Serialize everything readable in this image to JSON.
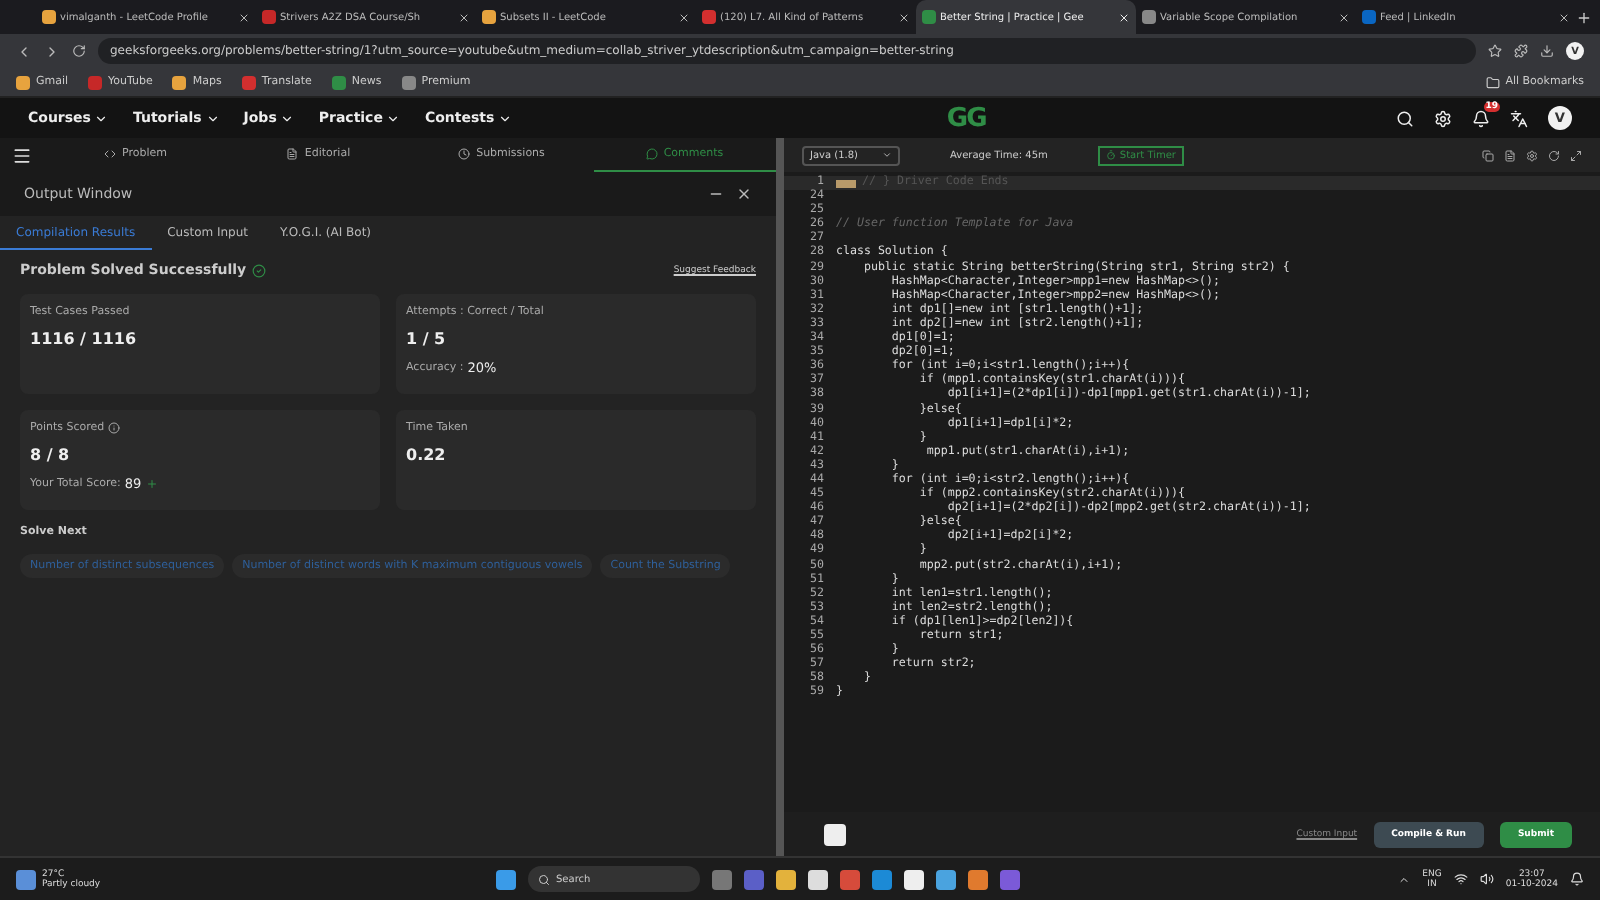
{
  "browser": {
    "tabs": [
      {
        "title": "vimalganth - LeetCode Profile",
        "selected": false
      },
      {
        "title": "Strivers A2Z DSA Course/Sh",
        "selected": false
      },
      {
        "title": "Subsets II - LeetCode",
        "selected": false
      },
      {
        "title": "(120) L7. All Kind of Patterns",
        "selected": false
      },
      {
        "title": "Better String | Practice | Gee",
        "selected": true
      },
      {
        "title": "Variable Scope Compilation",
        "selected": false
      },
      {
        "title": "Feed | LinkedIn",
        "selected": false
      }
    ],
    "url": "geeksforgeeks.org/problems/better-string/1?utm_source=youtube&utm_medium=collab_striver_ytdescription&utm_campaign=better-string",
    "profile_initial": "V",
    "bookmarks": [
      "Gmail",
      "YouTube",
      "Maps",
      "Translate",
      "News",
      "Premium"
    ],
    "all_bookmarks": "All Bookmarks"
  },
  "site_nav": {
    "menus": [
      "Courses",
      "Tutorials",
      "Jobs",
      "Practice",
      "Contests"
    ],
    "logo": "GG",
    "notification_count": "19",
    "avatar": "V"
  },
  "problem_tabs": [
    {
      "label": "Problem",
      "selected": false
    },
    {
      "label": "Editorial",
      "selected": false
    },
    {
      "label": "Submissions",
      "selected": false
    },
    {
      "label": "Comments",
      "selected": true
    }
  ],
  "output_window": {
    "title": "Output Window",
    "tabs": [
      {
        "label": "Compilation Results",
        "selected": true
      },
      {
        "label": "Custom Input",
        "selected": false
      },
      {
        "label": "Y.O.G.I. (AI Bot)",
        "selected": false
      }
    ],
    "status": "Problem Solved Successfully",
    "feedback": "Suggest Feedback",
    "cards": [
      {
        "label": "Test Cases Passed",
        "value": "1116 / 1116"
      },
      {
        "label": "Attempts : Correct / Total",
        "value": "1 / 5",
        "note_label": "Accuracy :",
        "note_value": "20%"
      },
      {
        "label": "Points Scored",
        "value": "8 / 8",
        "note_label": "Your Total Score:",
        "note_value": "89",
        "info": true,
        "up": true
      },
      {
        "label": "Time Taken",
        "value": "0.22"
      }
    ],
    "solve_next_title": "Solve Next",
    "solve_next": [
      "Number of distinct subsequences",
      "Number of distinct words with K maximum contiguous vowels",
      "Count the Substring"
    ]
  },
  "editor": {
    "language": "Java (1.8)",
    "average_time": "Average Time: 45m",
    "timer": "Start Timer",
    "lines": [
      {
        "n": "1",
        "kind": "folded",
        "text": "// } Driver Code Ends"
      },
      {
        "n": "24",
        "kind": "code"
      },
      {
        "n": "25",
        "kind": "code"
      },
      {
        "n": "26",
        "kind": "comment",
        "text": "// User function Template for Java"
      },
      {
        "n": "27",
        "kind": "code"
      },
      {
        "n": "28",
        "kind": "code",
        "text": "class Solution {"
      },
      {
        "n": "29",
        "kind": "code",
        "text": "    public static String betterString(String str1, String str2) {"
      },
      {
        "n": "30",
        "kind": "code",
        "text": "        HashMap<Character,Integer>mpp1=new HashMap<>();"
      },
      {
        "n": "31",
        "kind": "code",
        "text": "        HashMap<Character,Integer>mpp2=new HashMap<>();"
      },
      {
        "n": "32",
        "kind": "code",
        "text": "        int dp1[]=new int [str1.length()+1];"
      },
      {
        "n": "33",
        "kind": "code",
        "text": "        int dp2[]=new int [str2.length()+1];"
      },
      {
        "n": "34",
        "kind": "code",
        "text": "        dp1[0]=1;"
      },
      {
        "n": "35",
        "kind": "code",
        "text": "        dp2[0]=1;"
      },
      {
        "n": "36",
        "kind": "code",
        "text": "        for (int i=0;i<str1.length();i++){"
      },
      {
        "n": "37",
        "kind": "code",
        "text": "            if (mpp1.containsKey(str1.charAt(i))){"
      },
      {
        "n": "38",
        "kind": "code",
        "text": "                dp1[i+1]=(2*dp1[i])-dp1[mpp1.get(str1.charAt(i))-1];"
      },
      {
        "n": "39",
        "kind": "code",
        "text": "            }else{"
      },
      {
        "n": "40",
        "kind": "code",
        "text": "                dp1[i+1]=dp1[i]*2;"
      },
      {
        "n": "41",
        "kind": "code",
        "text": "            }"
      },
      {
        "n": "42",
        "kind": "code",
        "text": "             mpp1.put(str1.charAt(i),i+1);"
      },
      {
        "n": "43",
        "kind": "code",
        "text": "        }"
      },
      {
        "n": "44",
        "kind": "code",
        "text": "        for (int i=0;i<str2.length();i++){"
      },
      {
        "n": "45",
        "kind": "code",
        "text": "            if (mpp2.containsKey(str2.charAt(i))){"
      },
      {
        "n": "46",
        "kind": "code",
        "text": "                dp2[i+1]=(2*dp2[i])-dp2[mpp2.get(str2.charAt(i))-1];"
      },
      {
        "n": "47",
        "kind": "code",
        "text": "            }else{"
      },
      {
        "n": "48",
        "kind": "code",
        "text": "                dp2[i+1]=dp2[i]*2;"
      },
      {
        "n": "49",
        "kind": "code",
        "text": "            }"
      },
      {
        "n": "50",
        "kind": "code",
        "text": "            mpp2.put(str2.charAt(i),i+1);"
      },
      {
        "n": "51",
        "kind": "code",
        "text": "        }"
      },
      {
        "n": "52",
        "kind": "code",
        "text": "        int len1=str1.length();"
      },
      {
        "n": "53",
        "kind": "code",
        "text": "        int len2=str2.length();"
      },
      {
        "n": "54",
        "kind": "code",
        "text": "        if (dp1[len1]>=dp2[len2]){"
      },
      {
        "n": "55",
        "kind": "code",
        "text": "            return str1;"
      },
      {
        "n": "56",
        "kind": "code",
        "text": "        }"
      },
      {
        "n": "57",
        "kind": "code",
        "text": "        return str2;"
      },
      {
        "n": "58",
        "kind": "code",
        "text": "    }"
      },
      {
        "n": "59",
        "kind": "code",
        "text": "}"
      }
    ],
    "custom_input": "Custom Input",
    "compile": "Compile & Run",
    "submit": "Submit"
  },
  "taskbar": {
    "temperature": "27°C",
    "weather": "Partly cloudy",
    "search": "Search",
    "lang": "ENG",
    "region": "IN",
    "time": "23:07",
    "date": "01-10-2024"
  }
}
